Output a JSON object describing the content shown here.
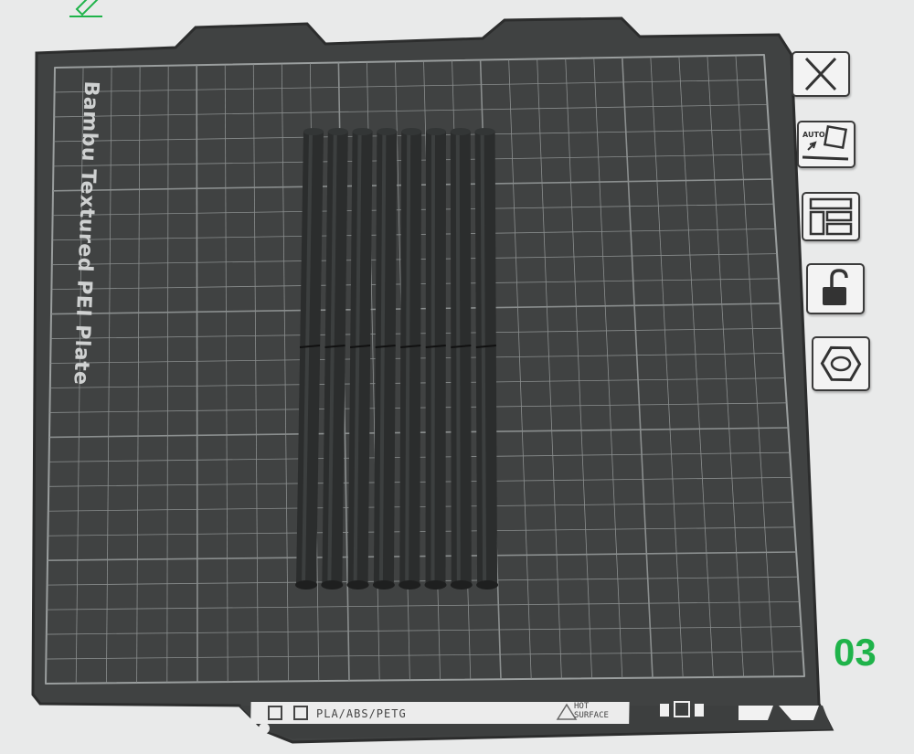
{
  "plate": {
    "name": "Bambu Textured PEI Plate",
    "number": "03",
    "material_label": "PLA/ABS/PETG",
    "warning_line1": "HOT",
    "warning_line2": "SURFACE"
  },
  "sidebar": {
    "buttons": [
      {
        "name": "close-plate-button",
        "icon": "close-icon"
      },
      {
        "name": "auto-orient-button",
        "icon": "auto-orient-icon",
        "text": "AUTO"
      },
      {
        "name": "arrange-button",
        "icon": "arrange-icon"
      },
      {
        "name": "lock-plate-button",
        "icon": "lock-open-icon"
      },
      {
        "name": "plate-settings-button",
        "icon": "hex-nut-icon"
      }
    ]
  },
  "toolbar": {
    "edit_icon": "pencil-icon"
  },
  "objects": {
    "count": 8,
    "type": "cylinder-rod"
  },
  "colors": {
    "background": "#e9eaea",
    "plate": "#404242",
    "grid": "#8a8e8e",
    "rod": "#2b2d2d",
    "accent": "#1fb34a"
  }
}
